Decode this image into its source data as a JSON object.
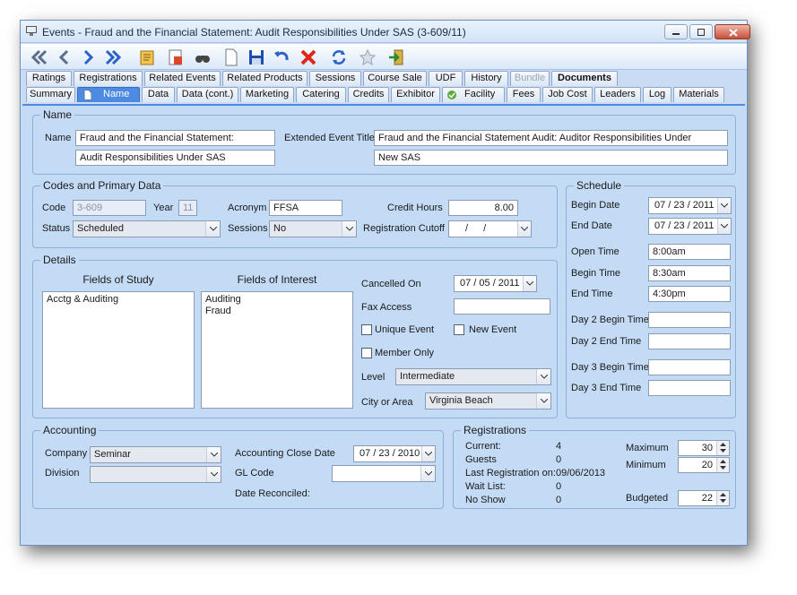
{
  "window": {
    "title": "Events - Fraud and the Financial Statement: Audit Responsibilities Under SAS (3-609/11)"
  },
  "toolbar": {
    "icons": [
      "first-record",
      "previous-record",
      "next-record",
      "last-record",
      "notes",
      "report",
      "binoculars",
      "new-document",
      "save",
      "undo",
      "delete",
      "refresh",
      "favorite",
      "exit"
    ]
  },
  "tabs_row1": [
    "Ratings",
    "Registrations",
    "Related Events",
    "Related Products",
    "Sessions",
    "Course Sale",
    "UDF",
    "History",
    "Bundle",
    "Documents"
  ],
  "tabs_row2": [
    "Summary",
    "Name",
    "Data",
    "Data (cont.)",
    "Marketing",
    "Catering",
    "Credits",
    "Exhibitor",
    "Facility",
    "Fees",
    "Job Cost",
    "Leaders",
    "Log",
    "Materials"
  ],
  "name_group": {
    "title": "Name",
    "name_label": "Name",
    "name_line1": "Fraud and the Financial Statement:",
    "name_line2": "Audit Responsibilities Under SAS",
    "ext_label": "Extended Event Title",
    "ext_line1": "Fraud and the Financial Statement Audit: Auditor Responsibilities Under",
    "ext_line2": "New SAS"
  },
  "codes_group": {
    "title": "Codes and Primary Data",
    "code_label": "Code",
    "code_value": "3-609",
    "year_label": "Year",
    "year_value": "11",
    "acronym_label": "Acronym",
    "acronym_value": "FFSA",
    "credit_label": "Credit Hours",
    "credit_value": "8.00",
    "status_label": "Status",
    "status_value": "Scheduled",
    "sessions_label": "Sessions",
    "sessions_value": "No",
    "cutoff_label": "Registration Cutoff",
    "cutoff_value": "/ /"
  },
  "details_group": {
    "title": "Details",
    "study_header": "Fields of Study",
    "study_items": [
      "Acctg & Auditing"
    ],
    "interest_header": "Fields of Interest",
    "interest_items": [
      "Auditing",
      "Fraud"
    ],
    "cancelled_label": "Cancelled On",
    "cancelled_value": "07 / 05 / 2011",
    "fax_label": "Fax Access",
    "fax_value": "",
    "unique_label": "Unique Event",
    "new_label": "New Event",
    "member_label": "Member Only",
    "level_label": "Level",
    "level_value": "Intermediate",
    "city_label": "City or Area",
    "city_value": "Virginia Beach"
  },
  "schedule_group": {
    "title": "Schedule",
    "begin_date_label": "Begin Date",
    "begin_date_value": "07 / 23 / 2011",
    "end_date_label": "End Date",
    "end_date_value": "07 / 23 / 2011",
    "open_label": "Open Time",
    "open_value": "8:00am",
    "begin_time_label": "Begin Time",
    "begin_time_value": "8:30am",
    "end_time_label": "End Time",
    "end_time_value": "4:30pm",
    "day2_begin_label": "Day 2 Begin Time",
    "day2_end_label": "Day 2 End Time",
    "day3_begin_label": "Day 3 Begin Time",
    "day3_end_label": "Day 3 End Time"
  },
  "accounting_group": {
    "title": "Accounting",
    "company_label": "Company",
    "company_value": "Seminar",
    "division_label": "Division",
    "division_value": "",
    "close_label": "Accounting Close Date",
    "close_value": "07 / 23 / 2010",
    "gl_label": "GL Code",
    "gl_value": "",
    "reconciled_label": "Date Reconciled:"
  },
  "registrations_group": {
    "title": "Registrations",
    "current_label": "Current:",
    "current_value": "4",
    "guests_label": "Guests",
    "guests_value": "0",
    "last_label": "Last Registration on:",
    "last_value": "09/06/2013",
    "wait_label": "Wait List:",
    "wait_value": "0",
    "noshow_label": "No Show",
    "noshow_value": "0",
    "max_label": "Maximum",
    "max_value": "30",
    "min_label": "Minimum",
    "min_value": "20",
    "budget_label": "Budgeted",
    "budget_value": "22"
  }
}
